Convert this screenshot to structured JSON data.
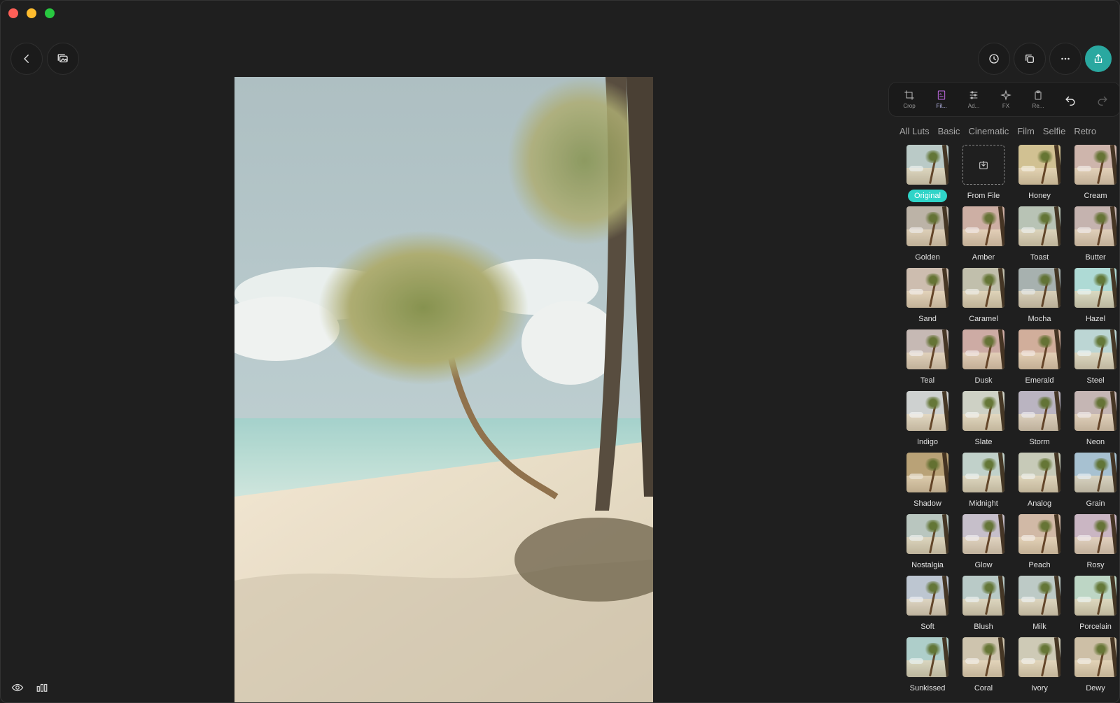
{
  "window": {
    "colors": {
      "background": "#1f1f1f",
      "accent": "#2aa8a0",
      "selected_badge": "#2fd4c8",
      "active_tool": "#c36be6"
    }
  },
  "top_left": {
    "back_icon": "chevron-left-icon",
    "gallery_icon": "gallery-icon"
  },
  "top_right": {
    "history_icon": "clock-icon",
    "compare_icon": "copy-icon",
    "more_icon": "ellipsis-icon",
    "share_icon": "share-icon"
  },
  "toolbar": {
    "tools": [
      {
        "label": "Crop",
        "icon": "crop-icon"
      },
      {
        "label": "Fil...",
        "icon": "filter-icon"
      },
      {
        "label": "Ad...",
        "icon": "sliders-icon"
      },
      {
        "label": "FX",
        "icon": "sparkle-icon"
      },
      {
        "label": "Re...",
        "icon": "clipboard-icon"
      }
    ],
    "undo_icon": "undo-icon",
    "redo_icon": "redo-icon"
  },
  "categories": [
    "All Luts",
    "Basic",
    "Cinematic",
    "Film",
    "Selfie",
    "Retro"
  ],
  "filters": [
    {
      "name": "Original",
      "tint": "#c9d6d4"
    },
    {
      "name": "From File",
      "tint": ""
    },
    {
      "name": "Honey",
      "tint": "#dccfa6"
    },
    {
      "name": "Cream",
      "tint": "#d9c5bd"
    },
    {
      "name": "Golden",
      "tint": "#cbc3b9"
    },
    {
      "name": "Amber",
      "tint": "#d8c0b6"
    },
    {
      "name": "Toast",
      "tint": "#c7d0c5"
    },
    {
      "name": "Butter",
      "tint": "#d2c3c0"
    },
    {
      "name": "Sand",
      "tint": "#d8ccc0"
    },
    {
      "name": "Caramel",
      "tint": "#cfcdbd"
    },
    {
      "name": "Mocha",
      "tint": "#b9c1c0"
    },
    {
      "name": "Hazel",
      "tint": "#bfe3df"
    },
    {
      "name": "Teal",
      "tint": "#d3c8c4"
    },
    {
      "name": "Dusk",
      "tint": "#d8bcb6"
    },
    {
      "name": "Emerald",
      "tint": "#dcbfae"
    },
    {
      "name": "Steel",
      "tint": "#cbe0de"
    },
    {
      "name": "Indigo",
      "tint": "#d9dcdb"
    },
    {
      "name": "Slate",
      "tint": "#d9dcd2"
    },
    {
      "name": "Storm",
      "tint": "#c9c4cf"
    },
    {
      "name": "Neon",
      "tint": "#d2c6c4"
    },
    {
      "name": "Shadow",
      "tint": "#c8b58d"
    },
    {
      "name": "Midnight",
      "tint": "#cfdcd6"
    },
    {
      "name": "Analog",
      "tint": "#d4d6c7"
    },
    {
      "name": "Grain",
      "tint": "#b9cfdc"
    },
    {
      "name": "Nostalgia",
      "tint": "#c8d3cd"
    },
    {
      "name": "Glow",
      "tint": "#d3cdd6"
    },
    {
      "name": "Peach",
      "tint": "#dcc8b8"
    },
    {
      "name": "Rosy",
      "tint": "#d6c6d0"
    },
    {
      "name": "Soft",
      "tint": "#ccd3dc"
    },
    {
      "name": "Blush",
      "tint": "#c8d6d4"
    },
    {
      "name": "Milk",
      "tint": "#ccd6d3"
    },
    {
      "name": "Porcelain",
      "tint": "#cce0d2"
    },
    {
      "name": "Sunkissed",
      "tint": "#bfd9d6"
    },
    {
      "name": "Coral",
      "tint": "#d9d1bf"
    },
    {
      "name": "Ivory",
      "tint": "#d9d6c6"
    },
    {
      "name": "Dewy",
      "tint": "#d8cdb8"
    }
  ],
  "selected_filter": "Original",
  "bottom_left": {
    "preview_icon": "eye-icon",
    "histogram_icon": "histogram-icon"
  }
}
